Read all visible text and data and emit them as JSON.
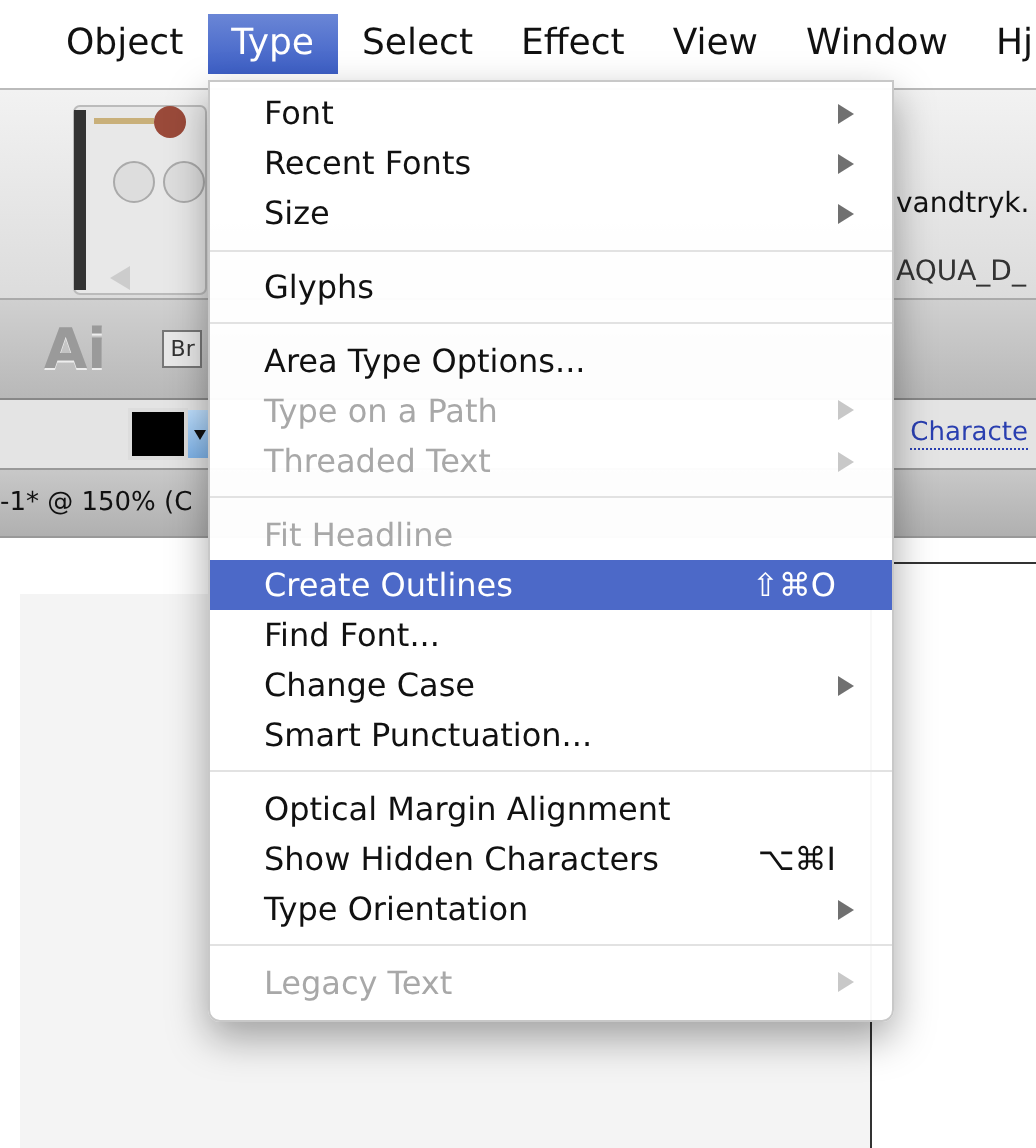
{
  "menu_bar": [
    {
      "label": "Object",
      "selected": false
    },
    {
      "label": "Type",
      "selected": true
    },
    {
      "label": "Select",
      "selected": false
    },
    {
      "label": "Effect",
      "selected": false
    },
    {
      "label": "View",
      "selected": false
    },
    {
      "label": "Window",
      "selected": false
    },
    {
      "label": "Hj",
      "selected": false
    }
  ],
  "browser": {
    "tab_title": "vandtryk.",
    "address": "AQUA_D_"
  },
  "app_bar": {
    "app_badge": "Ai",
    "bridge_button": "Br"
  },
  "control_bar": {
    "panel_link": "Characte"
  },
  "document_tab": {
    "title": "-1* @ 150% (C"
  },
  "type_menu": [
    {
      "kind": "item",
      "label": "Font",
      "disabled": false,
      "selected": false,
      "submenu": true
    },
    {
      "kind": "item",
      "label": "Recent Fonts",
      "disabled": false,
      "selected": false,
      "submenu": true
    },
    {
      "kind": "item",
      "label": "Size",
      "disabled": false,
      "selected": false,
      "submenu": true
    },
    {
      "kind": "separator"
    },
    {
      "kind": "item",
      "label": "Glyphs",
      "disabled": false,
      "selected": false,
      "submenu": false
    },
    {
      "kind": "separator"
    },
    {
      "kind": "item",
      "label": "Area Type Options...",
      "disabled": false,
      "selected": false,
      "submenu": false
    },
    {
      "kind": "item",
      "label": "Type on a Path",
      "disabled": true,
      "selected": false,
      "submenu": true
    },
    {
      "kind": "item",
      "label": "Threaded Text",
      "disabled": true,
      "selected": false,
      "submenu": true
    },
    {
      "kind": "separator"
    },
    {
      "kind": "item",
      "label": "Fit Headline",
      "disabled": true,
      "selected": false,
      "submenu": false
    },
    {
      "kind": "item",
      "label": "Create Outlines",
      "disabled": false,
      "selected": true,
      "submenu": false,
      "shortcut": "⇧⌘O"
    },
    {
      "kind": "item",
      "label": "Find Font...",
      "disabled": false,
      "selected": false,
      "submenu": false
    },
    {
      "kind": "item",
      "label": "Change Case",
      "disabled": false,
      "selected": false,
      "submenu": true
    },
    {
      "kind": "item",
      "label": "Smart Punctuation...",
      "disabled": false,
      "selected": false,
      "submenu": false
    },
    {
      "kind": "separator"
    },
    {
      "kind": "item",
      "label": "Optical Margin Alignment",
      "disabled": false,
      "selected": false,
      "submenu": false
    },
    {
      "kind": "item",
      "label": "Show Hidden Characters",
      "disabled": false,
      "selected": false,
      "submenu": false,
      "shortcut": "⌥⌘I"
    },
    {
      "kind": "item",
      "label": "Type Orientation",
      "disabled": false,
      "selected": false,
      "submenu": true
    },
    {
      "kind": "separator"
    },
    {
      "kind": "item",
      "label": "Legacy Text",
      "disabled": true,
      "selected": false,
      "submenu": true
    }
  ]
}
